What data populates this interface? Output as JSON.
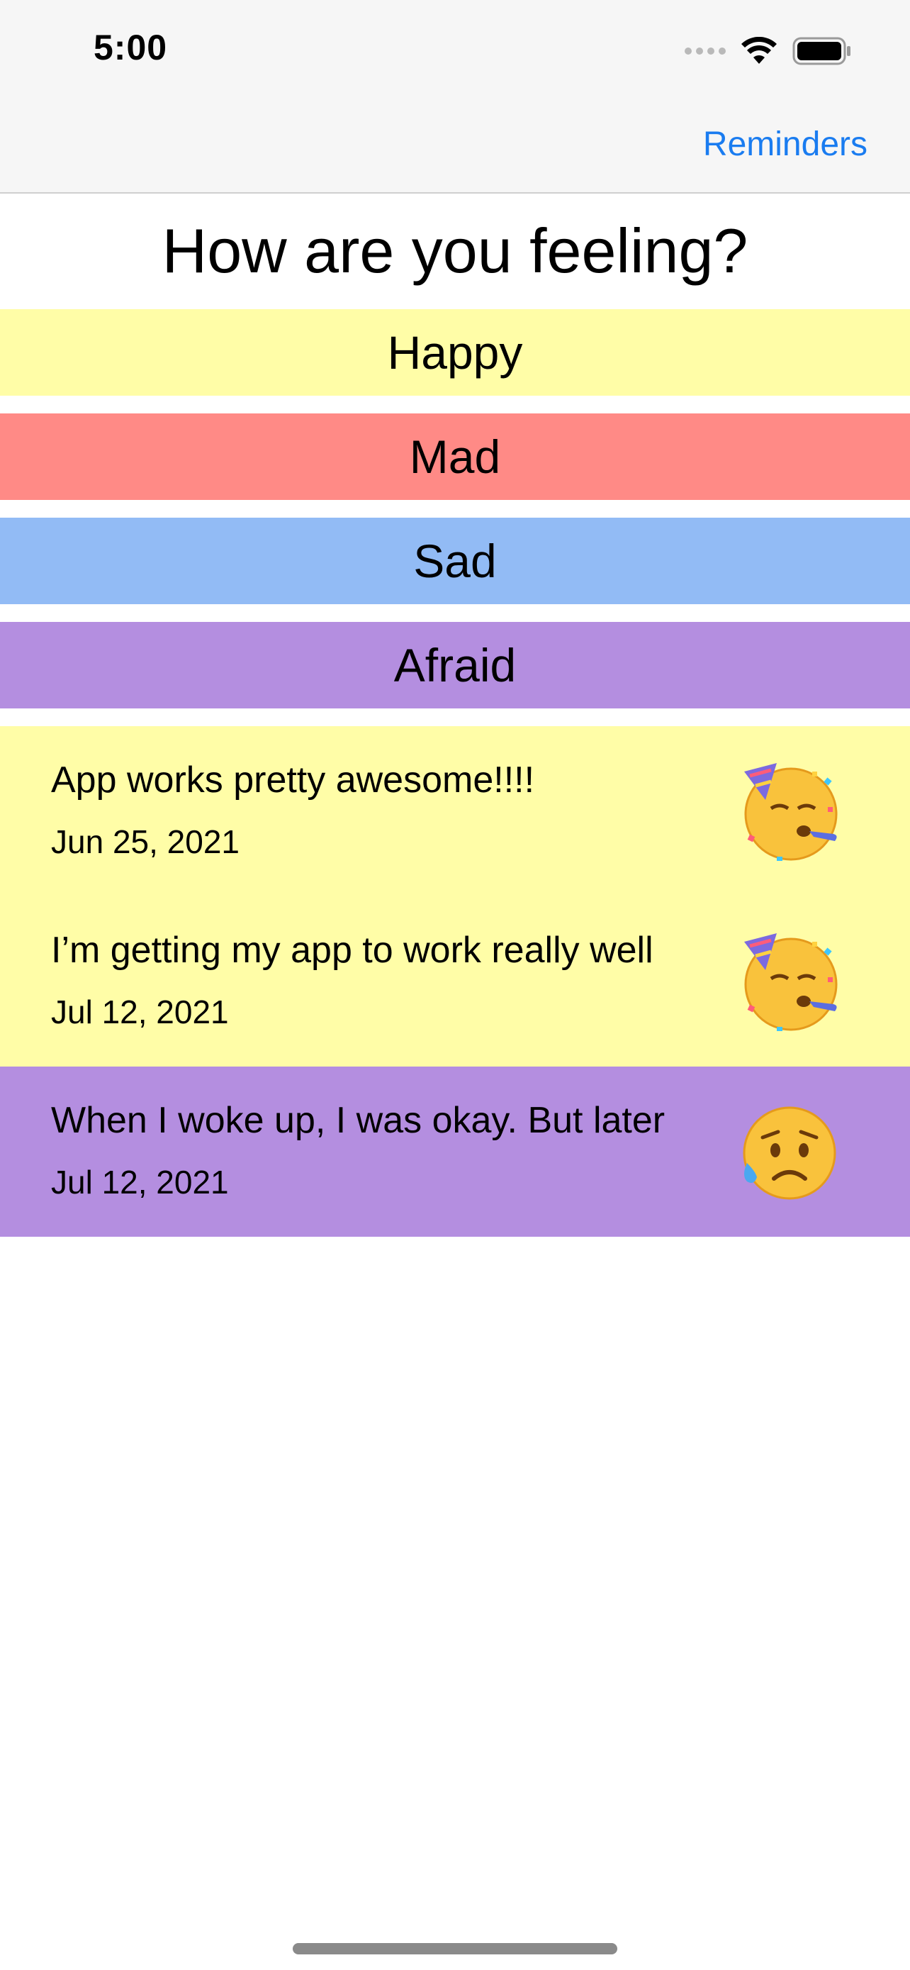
{
  "status_bar": {
    "time": "5:00"
  },
  "nav": {
    "reminders_label": "Reminders"
  },
  "title": "How are you feeling?",
  "moods": [
    {
      "label": "Happy",
      "color": "#fffda7"
    },
    {
      "label": "Mad",
      "color": "#ff8a86"
    },
    {
      "label": "Sad",
      "color": "#92bbf5"
    },
    {
      "label": "Afraid",
      "color": "#b48ee0"
    }
  ],
  "entries": [
    {
      "text": "App works pretty awesome!!!!",
      "date": "Jun 25, 2021",
      "mood": "Happy",
      "emoji": "partying-face-icon",
      "color": "#fffda7"
    },
    {
      "text": "I’m getting my app to work really well",
      "date": "Jul 12, 2021",
      "mood": "Happy",
      "emoji": "partying-face-icon",
      "color": "#fffda7"
    },
    {
      "text": "When I woke up, I was okay. But later",
      "date": "Jul 12, 2021",
      "mood": "Afraid",
      "emoji": "sad-but-relieved-face-icon",
      "color": "#b48ee0"
    }
  ],
  "colors": {
    "accent": "#1a7cf0",
    "nav_background": "#f6f6f6"
  }
}
